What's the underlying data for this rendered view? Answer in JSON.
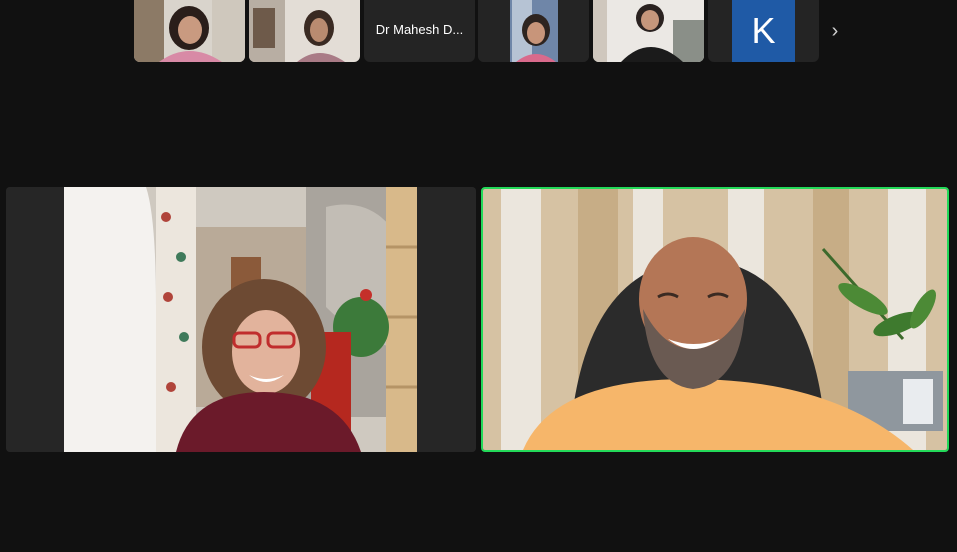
{
  "meeting": {
    "thumbnails": [
      {
        "id": "p1",
        "type": "video"
      },
      {
        "id": "p2",
        "type": "video"
      },
      {
        "id": "p3",
        "type": "name",
        "name": "Dr Mahesh D..."
      },
      {
        "id": "p4",
        "type": "video"
      },
      {
        "id": "p5",
        "type": "video"
      },
      {
        "id": "p6",
        "type": "avatar",
        "initial": "K",
        "color": "#1f5aa6"
      }
    ],
    "next_icon": "›",
    "active_speaker_border": "#23d959",
    "background": "#111111"
  }
}
